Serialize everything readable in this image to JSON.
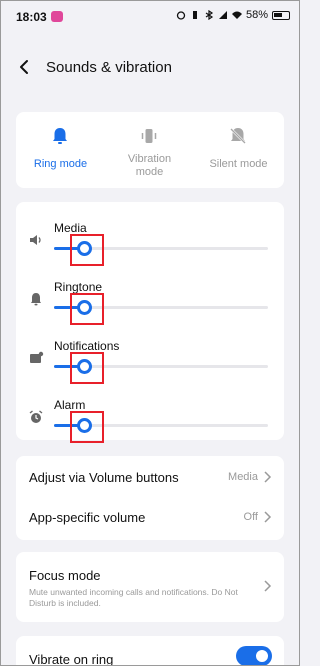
{
  "status_bar": {
    "time": "18:03",
    "battery": "58%"
  },
  "header": {
    "title": "Sounds & vibration"
  },
  "modes": [
    {
      "label": "Ring mode",
      "active": true
    },
    {
      "label": "Vibration mode",
      "active": false
    },
    {
      "label": "Silent mode",
      "active": false
    }
  ],
  "volumes": [
    {
      "label": "Media",
      "icon": "speaker-icon",
      "level": 0.14
    },
    {
      "label": "Ringtone",
      "icon": "bell-icon",
      "level": 0.14
    },
    {
      "label": "Notifications",
      "icon": "notification-icon",
      "level": 0.14
    },
    {
      "label": "Alarm",
      "icon": "alarm-clock-icon",
      "level": 0.14
    }
  ],
  "settings": {
    "adjust_label": "Adjust via Volume buttons",
    "adjust_value": "Media",
    "app_volume_label": "App-specific volume",
    "app_volume_value": "Off"
  },
  "focus": {
    "title": "Focus mode",
    "description": "Mute unwanted incoming calls and notifications. Do Not Disturb is included."
  },
  "vibrate": {
    "label": "Vibrate on ring",
    "enabled": true
  },
  "colors": {
    "accent": "#1a6ee8",
    "highlight": "#e8202a",
    "background": "#f2f2f6"
  }
}
